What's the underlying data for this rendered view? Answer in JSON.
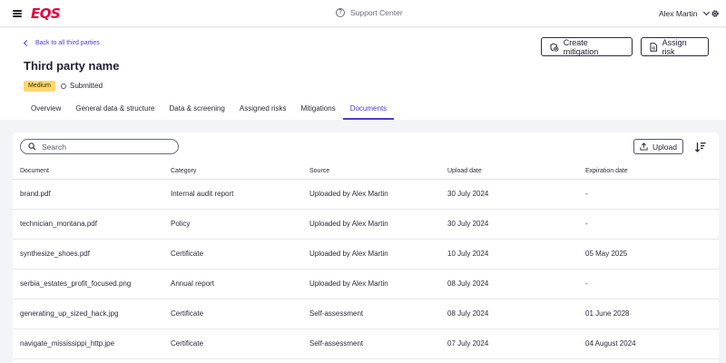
{
  "topbar": {
    "logo": "EQS",
    "support_label": "Support Center",
    "user_name": "Alex Martin"
  },
  "header": {
    "back_label": "Back to all third parties",
    "title": "Third party name",
    "risk_badge": "Medium",
    "status": "Submitted",
    "create_mitigation_label": "Create mitigation",
    "assign_risk_label": "Assign risk"
  },
  "tabs": [
    {
      "label": "Overview",
      "active": false
    },
    {
      "label": "General data & structure",
      "active": false
    },
    {
      "label": "Data & screening",
      "active": false
    },
    {
      "label": "Assigned risks",
      "active": false
    },
    {
      "label": "Mitigations",
      "active": false
    },
    {
      "label": "Documents",
      "active": true
    }
  ],
  "documents": {
    "search_placeholder": "Search",
    "upload_label": "Upload",
    "columns": [
      "Document",
      "Category",
      "Source",
      "Upload date",
      "Expiration date"
    ],
    "rows": [
      [
        "brand.pdf",
        "Internal audit report",
        "Uploaded by Alex Martin",
        "30 July 2024",
        "-"
      ],
      [
        "technician_montana.pdf",
        "Policy",
        "Uploaded by Alex Martin",
        "30 July 2024",
        "-"
      ],
      [
        "synthesize_shoes.pdf",
        "Certificate",
        "Uploaded by Alex Martin",
        "10 July 2024",
        "05 May 2025"
      ],
      [
        "serbia_estates_profit_focused.png",
        "Annual report",
        "Uploaded by Alex Martin",
        "08 July 2024",
        "-"
      ],
      [
        "generating_up_sized_hack.jpg",
        "Certificate",
        "Self-assessment",
        "08 July 2024",
        "01 June 2028"
      ],
      [
        "navigate_mississippi_http.jpe",
        "Certificate",
        "Self-assessment",
        "07 July 2024",
        "04 August 2024"
      ]
    ]
  },
  "colors": {
    "accent": "#4d3bd1",
    "brand": "#e4003a",
    "medium_badge": "#ffd66e"
  }
}
